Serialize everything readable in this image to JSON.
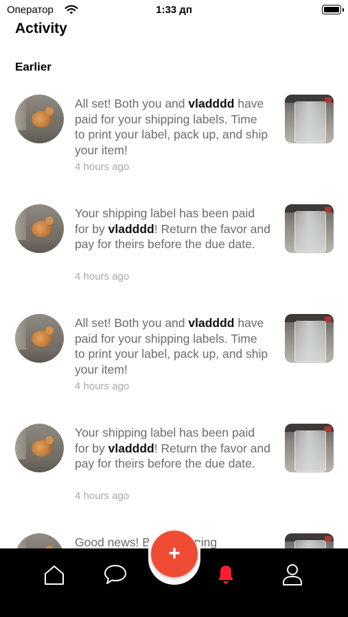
{
  "status_bar": {
    "carrier": "Оператор",
    "time": "1:33 дп",
    "wifi_icon": "wifi-icon",
    "battery_icon": "battery-icon"
  },
  "header": {
    "title": "Activity"
  },
  "section": {
    "title": "Earlier"
  },
  "notifications": [
    {
      "text_before": "All set! Both you and ",
      "username": "vladddd",
      "text_after": " have paid for your shipping labels. Time to print your label, pack up, and ship your item!",
      "time": "4 hours ago"
    },
    {
      "text_before": "Your shipping label has been paid for by ",
      "username": "vladddd",
      "text_after": "! Return the favor and pay for theirs before the due date.",
      "time": "4 hours ago"
    },
    {
      "text_before": "All set! Both you and ",
      "username": "vladddd",
      "text_after": " have paid for your shipping labels. Time to print your label, pack up, and ship your item!",
      "time": "4 hours ago"
    },
    {
      "text_before": "Your shipping label has been paid for by ",
      "username": "vladddd",
      "text_after": "! Return the favor and pay for theirs before the due date.",
      "time": "4 hours ago"
    },
    {
      "text_before": "Good news! B",
      "username": "",
      "text_after": "shipping"
    }
  ],
  "tab_bar": {
    "items": [
      {
        "icon": "home-icon"
      },
      {
        "icon": "chat-icon"
      },
      {
        "icon": "plus-icon",
        "label": "+"
      },
      {
        "icon": "bell-icon"
      },
      {
        "icon": "profile-icon"
      }
    ],
    "active_color": "#ff1f2c",
    "fab_color": "#f04c34",
    "background": "#000000"
  }
}
